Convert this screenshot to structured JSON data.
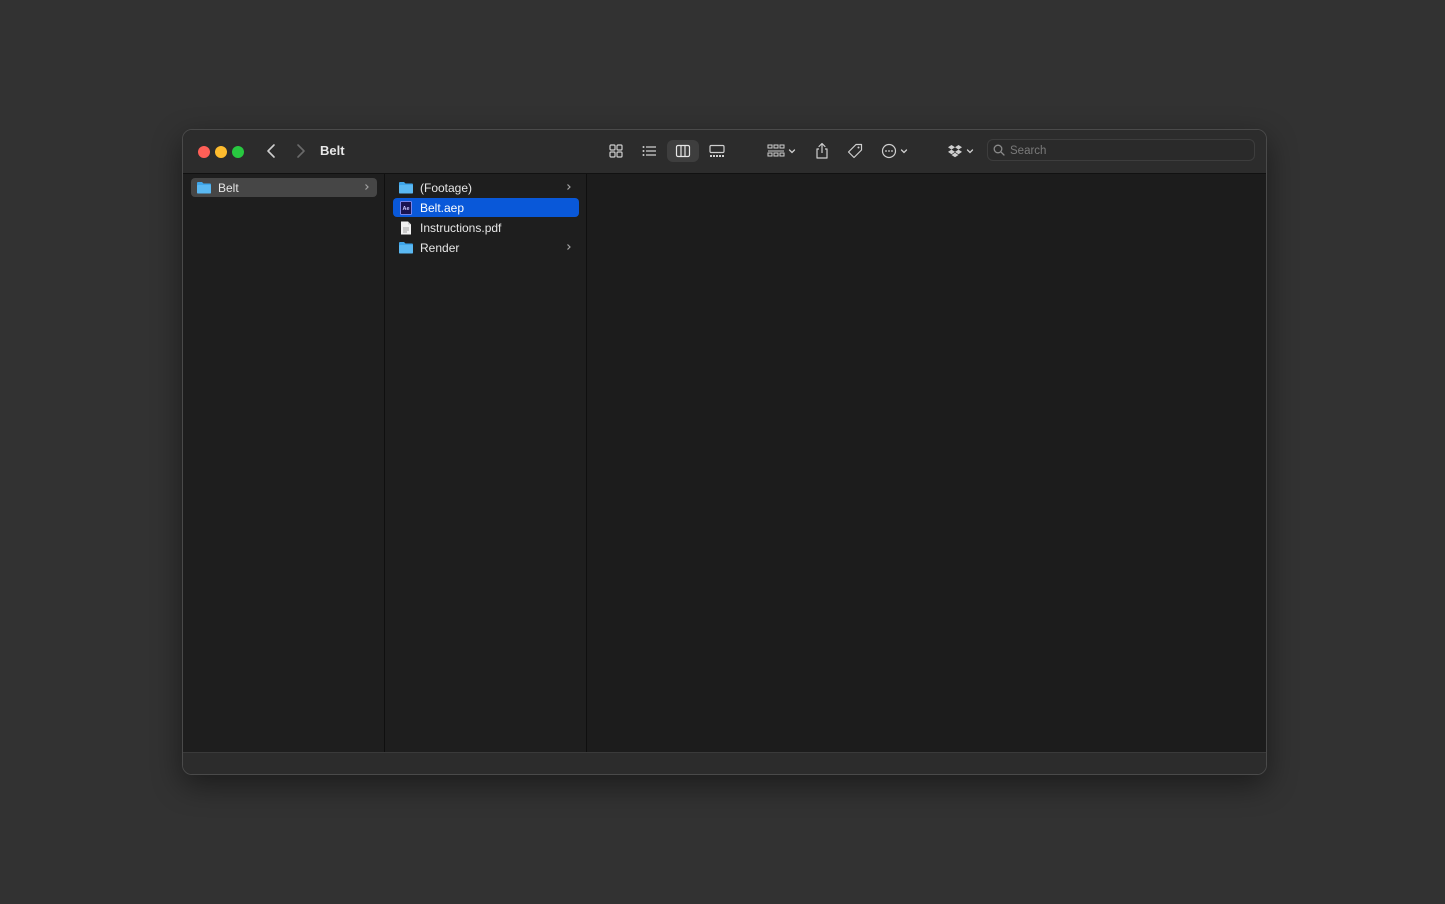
{
  "window": {
    "title": "Belt",
    "search_placeholder": "Search"
  },
  "toolbar": {
    "icons": [
      "icon-view-icon",
      "list-view-icon",
      "column-view-icon",
      "gallery-view-icon",
      "group-icon",
      "share-icon",
      "tag-icon",
      "more-icon",
      "dropbox-icon"
    ],
    "active_view": "column"
  },
  "columns": [
    {
      "items": [
        {
          "label": "Belt",
          "type": "folder",
          "state": "parent-selected"
        }
      ]
    },
    {
      "items": [
        {
          "label": "(Footage)",
          "type": "folder",
          "state": ""
        },
        {
          "label": "Belt.aep",
          "type": "aep",
          "state": "selected"
        },
        {
          "label": "Instructions.pdf",
          "type": "pdf",
          "state": ""
        },
        {
          "label": "Render",
          "type": "folder",
          "state": ""
        }
      ]
    }
  ],
  "colors": {
    "selection": "#0958d9",
    "folder": "#3fa6ea",
    "close": "#ff5f57",
    "minimize": "#febc2e",
    "maximize": "#28c840"
  }
}
